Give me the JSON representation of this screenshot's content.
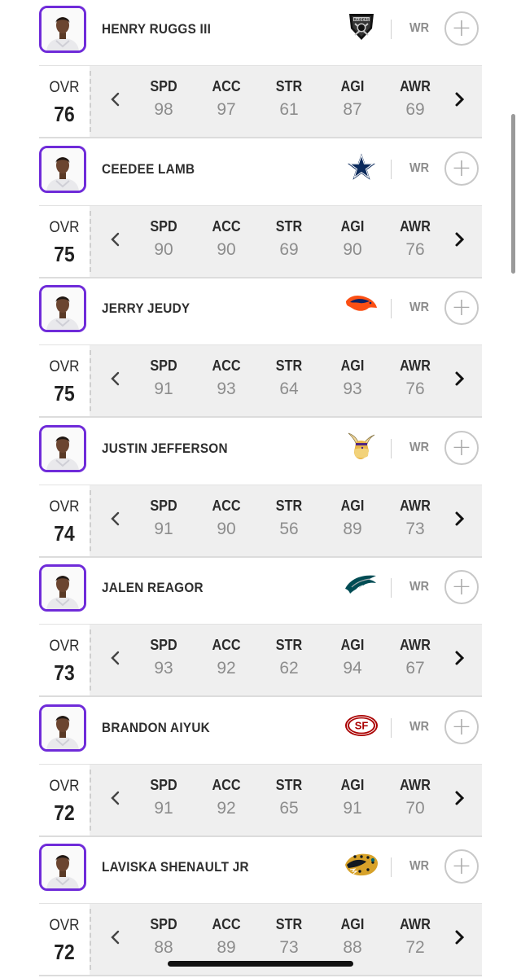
{
  "players": [
    {
      "name": "HENRY  RUGGS III",
      "team": "raiders",
      "pos": "WR",
      "ovr_label": "OVR",
      "ovr": "76",
      "stats": [
        {
          "label": "SPD",
          "value": "98"
        },
        {
          "label": "ACC",
          "value": "97"
        },
        {
          "label": "STR",
          "value": "61"
        },
        {
          "label": "AGI",
          "value": "87"
        },
        {
          "label": "AWR",
          "value": "69"
        }
      ]
    },
    {
      "name": "CEEDEE  LAMB",
      "team": "cowboys",
      "pos": "WR",
      "ovr_label": "OVR",
      "ovr": "75",
      "stats": [
        {
          "label": "SPD",
          "value": "90"
        },
        {
          "label": "ACC",
          "value": "90"
        },
        {
          "label": "STR",
          "value": "69"
        },
        {
          "label": "AGI",
          "value": "90"
        },
        {
          "label": "AWR",
          "value": "76"
        }
      ]
    },
    {
      "name": "JERRY  JEUDY",
      "team": "broncos",
      "pos": "WR",
      "ovr_label": "OVR",
      "ovr": "75",
      "stats": [
        {
          "label": "SPD",
          "value": "91"
        },
        {
          "label": "ACC",
          "value": "93"
        },
        {
          "label": "STR",
          "value": "64"
        },
        {
          "label": "AGI",
          "value": "93"
        },
        {
          "label": "AWR",
          "value": "76"
        }
      ]
    },
    {
      "name": "JUSTIN  JEFFERSON",
      "team": "vikings",
      "pos": "WR",
      "ovr_label": "OVR",
      "ovr": "74",
      "stats": [
        {
          "label": "SPD",
          "value": "91"
        },
        {
          "label": "ACC",
          "value": "90"
        },
        {
          "label": "STR",
          "value": "56"
        },
        {
          "label": "AGI",
          "value": "89"
        },
        {
          "label": "AWR",
          "value": "73"
        }
      ]
    },
    {
      "name": "JALEN  REAGOR",
      "team": "eagles",
      "pos": "WR",
      "ovr_label": "OVR",
      "ovr": "73",
      "stats": [
        {
          "label": "SPD",
          "value": "93"
        },
        {
          "label": "ACC",
          "value": "92"
        },
        {
          "label": "STR",
          "value": "62"
        },
        {
          "label": "AGI",
          "value": "94"
        },
        {
          "label": "AWR",
          "value": "67"
        }
      ]
    },
    {
      "name": "BRANDON  AIYUK",
      "team": "49ers",
      "pos": "WR",
      "ovr_label": "OVR",
      "ovr": "72",
      "stats": [
        {
          "label": "SPD",
          "value": "91"
        },
        {
          "label": "ACC",
          "value": "92"
        },
        {
          "label": "STR",
          "value": "65"
        },
        {
          "label": "AGI",
          "value": "91"
        },
        {
          "label": "AWR",
          "value": "70"
        }
      ]
    },
    {
      "name": "LAVISKA  SHENAULT JR",
      "team": "jaguars",
      "pos": "WR",
      "ovr_label": "OVR",
      "ovr": "72",
      "stats": [
        {
          "label": "SPD",
          "value": "88"
        },
        {
          "label": "ACC",
          "value": "89"
        },
        {
          "label": "STR",
          "value": "73"
        },
        {
          "label": "AGI",
          "value": "88"
        },
        {
          "label": "AWR",
          "value": "72"
        }
      ]
    }
  ],
  "icons": {
    "add": "plus-icon",
    "prev": "chevron-left-icon",
    "next": "chevron-right-icon"
  },
  "logo_text": {
    "raiders": "RAIDERS",
    "49ers": "SF"
  },
  "colors": {
    "accent": "#6f2bd9",
    "stats_bg": "#efefef"
  }
}
